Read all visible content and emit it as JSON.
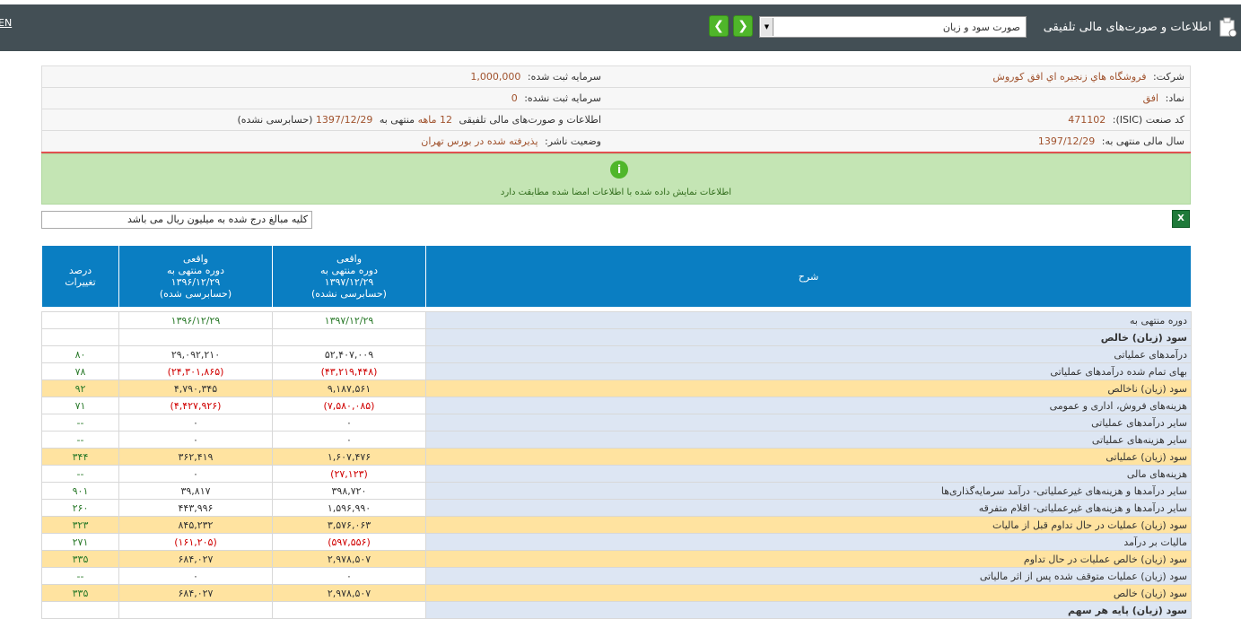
{
  "header": {
    "title": "اطلاعات و صورت‌های مالی تلفیقی",
    "report_select": "صورت سود و زیان",
    "lang": "EN",
    "colors": {
      "bar": "#434f55",
      "nav": "#4fb62a"
    }
  },
  "info": {
    "company_label": "شرکت:",
    "company_value": "فروشگاه هاي زنجيره اي افق كوروش",
    "capital_reg_label": "سرمایه ثبت شده:",
    "capital_reg_value": "1,000,000",
    "symbol_label": "نماد:",
    "symbol_value": "افق",
    "capital_unreg_label": "سرمایه ثبت نشده:",
    "capital_unreg_value": "0",
    "isic_label": "کد صنعت (ISIC):",
    "isic_value": "471102",
    "period_text_1": "اطلاعات و صورت‌های مالی تلفیقی",
    "period_months": "12 ماهه",
    "period_text_2": "منتهی به",
    "period_date": "1397/12/29",
    "period_status": "(حسابرسی نشده)",
    "fy_label": "سال مالی منتهی به:",
    "fy_value": "1397/12/29",
    "publisher_label": "وضعیت ناشر:",
    "publisher_value": "پذیرفته شده در بورس تهران"
  },
  "notice": {
    "text": "اطلاعات نمایش داده شده با اطلاعات امضا شده مطابقت دارد"
  },
  "unit_note": "کلیه مبالغ درج شده به میلیون ریال می باشد",
  "table": {
    "headers": {
      "desc": "شرح",
      "col1": [
        "واقعی",
        "دوره منتهی به",
        "۱۳۹۷/۱۲/۲۹",
        "(حسابرسی نشده)"
      ],
      "col2": [
        "واقعی",
        "دوره منتهی به",
        "۱۳۹۶/۱۲/۲۹",
        "(حسابرسی شده)"
      ],
      "col3": [
        "درصد",
        "تغییرات"
      ]
    },
    "rows": [
      {
        "desc": "دوره منتهی به",
        "v1": "۱۳۹۷/۱۲/۲۹",
        "v2": "۱۳۹۶/۱۲/۲۹",
        "pct": "",
        "type": "date"
      },
      {
        "desc": "سود (زیان) خالص",
        "v1": "",
        "v2": "",
        "pct": "",
        "type": "section"
      },
      {
        "desc": "درآمدهای عملیاتی",
        "v1": "۵۲,۴۰۷,۰۰۹",
        "v2": "۲۹,۰۹۲,۲۱۰",
        "pct": "۸۰",
        "type": "normal"
      },
      {
        "desc": "بهای تمام شده درآمدهای عملیاتی",
        "v1": "(۴۳,۲۱۹,۴۴۸)",
        "v2": "(۲۴,۳۰۱,۸۶۵)",
        "pct": "۷۸",
        "type": "neg"
      },
      {
        "desc": "سود (زیان) ناخالص",
        "v1": "۹,۱۸۷,۵۶۱",
        "v2": "۴,۷۹۰,۳۴۵",
        "pct": "۹۲",
        "type": "hl"
      },
      {
        "desc": "هزینه‌های فروش، اداری و عمومی",
        "v1": "(۷,۵۸۰,۰۸۵)",
        "v2": "(۴,۴۲۷,۹۲۶)",
        "pct": "۷۱",
        "type": "neg"
      },
      {
        "desc": "سایر درآمدهای عملیاتی",
        "v1": "۰",
        "v2": "۰",
        "pct": "--",
        "type": "normal"
      },
      {
        "desc": "سایر هزینه‌های عملیاتی",
        "v1": "۰",
        "v2": "۰",
        "pct": "--",
        "type": "normal"
      },
      {
        "desc": "سود (زیان) عملیاتی",
        "v1": "۱,۶۰۷,۴۷۶",
        "v2": "۳۶۲,۴۱۹",
        "pct": "۳۴۴",
        "type": "hl"
      },
      {
        "desc": "هزینه‌های مالی",
        "v1": "(۲۷,۱۲۳)",
        "v2": "۰",
        "pct": "--",
        "type": "neg1"
      },
      {
        "desc": "سایر درآمدها و هزینه‌های غیرعملیاتی- درآمد سرمایه‌گذاری‌ها",
        "v1": "۳۹۸,۷۲۰",
        "v2": "۳۹,۸۱۷",
        "pct": "۹۰۱",
        "type": "normal"
      },
      {
        "desc": "سایر درآمدها و هزینه‌های غیرعملیاتی- اقلام متفرقه",
        "v1": "۱,۵۹۶,۹۹۰",
        "v2": "۴۴۳,۹۹۶",
        "pct": "۲۶۰",
        "type": "normal"
      },
      {
        "desc": "سود (زیان) عملیات در حال تداوم قبل از مالیات",
        "v1": "۳,۵۷۶,۰۶۳",
        "v2": "۸۴۵,۲۳۲",
        "pct": "۳۲۳",
        "type": "hl"
      },
      {
        "desc": "مالیات بر درآمد",
        "v1": "(۵۹۷,۵۵۶)",
        "v2": "(۱۶۱,۲۰۵)",
        "pct": "۲۷۱",
        "type": "neg"
      },
      {
        "desc": "سود (زیان) خالص عملیات در حال تداوم",
        "v1": "۲,۹۷۸,۵۰۷",
        "v2": "۶۸۴,۰۲۷",
        "pct": "۳۳۵",
        "type": "hl"
      },
      {
        "desc": "سود (زیان) عملیات متوقف شده پس از اثر مالیاتی",
        "v1": "۰",
        "v2": "۰",
        "pct": "--",
        "type": "normal"
      },
      {
        "desc": "سود (زیان) خالص",
        "v1": "۲,۹۷۸,۵۰۷",
        "v2": "۶۸۴,۰۲۷",
        "pct": "۳۳۵",
        "type": "hl"
      },
      {
        "desc": "سود (زیان) پایه هر سهم",
        "v1": "",
        "v2": "",
        "pct": "",
        "type": "section"
      }
    ]
  }
}
